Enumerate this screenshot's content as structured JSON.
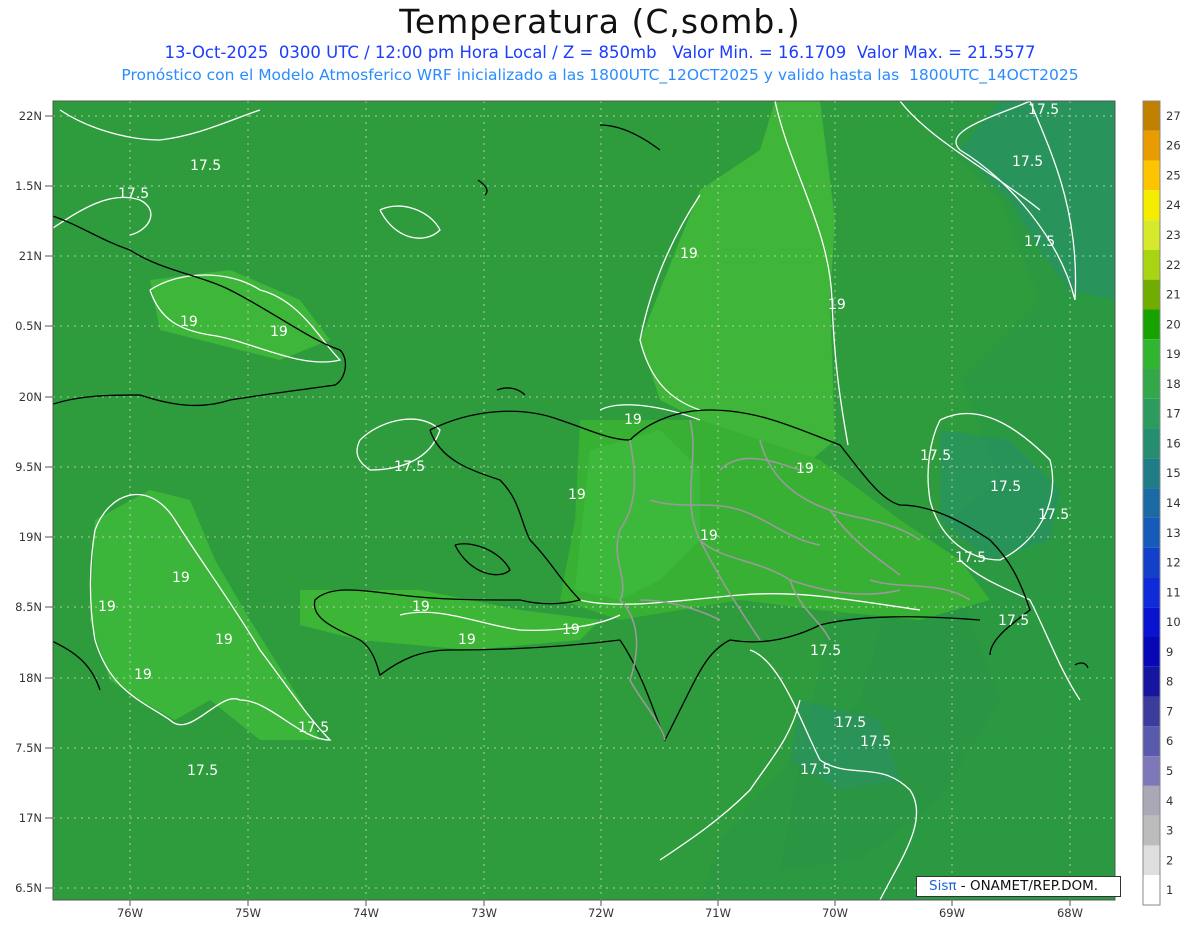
{
  "title": "Temperatura (C,somb.)",
  "subtitle_line1": "13-Oct-2025  0300 UTC / 12:00 pm Hora Local / Z = 850mb   Valor Min. = 16.1709  Valor Max. = 21.5577",
  "subtitle_line2": "Pronóstico con el Modelo Atmosferico WRF inicializado a las 1800UTC_12OCT2025 y valido hasta las  1800UTC_14OCT2025",
  "credit_sis": "Sisπ",
  "credit_rest": " - ONAMET/REP.DOM.",
  "lat_ticks": [
    "22N",
    "1.5N",
    "21N",
    "0.5N",
    "20N",
    "9.5N",
    "19N",
    "8.5N",
    "18N",
    "7.5N",
    "17N",
    "6.5N"
  ],
  "lon_ticks": [
    "76W",
    "75W",
    "74W",
    "73W",
    "72W",
    "71W",
    "70W",
    "69W",
    "68W"
  ],
  "colorbar_labels": [
    "27",
    "26",
    "25",
    "24",
    "23",
    "22",
    "21",
    "20",
    "19",
    "18",
    "17",
    "16",
    "15",
    "14",
    "13",
    "12",
    "11",
    "10",
    "9",
    "8",
    "7",
    "6",
    "5",
    "4",
    "3",
    "2",
    "1"
  ],
  "colorbar_colors": [
    "#c17f00",
    "#e89c00",
    "#ffc400",
    "#f5ed00",
    "#d6ea2b",
    "#a8d412",
    "#6fae00",
    "#18a200",
    "#2fb52f",
    "#32a84a",
    "#2d9b5e",
    "#268e70",
    "#1f7d88",
    "#1a6aa3",
    "#165bb9",
    "#1240c9",
    "#0e2ad9",
    "#0913d0",
    "#0707b6",
    "#1515a0",
    "#3c3c9f",
    "#5a5aad",
    "#7e78bb",
    "#a8a8b6",
    "#bcbcbc",
    "#dedede",
    "#ffffff"
  ],
  "contour_labels": [
    {
      "text": "17.5"
    },
    {
      "text": "17.5"
    },
    {
      "text": "19"
    },
    {
      "text": "19"
    },
    {
      "text": "19"
    },
    {
      "text": "19"
    },
    {
      "text": "19"
    },
    {
      "text": "19"
    },
    {
      "text": "19"
    },
    {
      "text": "19"
    },
    {
      "text": "19"
    },
    {
      "text": "19"
    },
    {
      "text": "19"
    },
    {
      "text": "19"
    },
    {
      "text": "19"
    },
    {
      "text": "19"
    },
    {
      "text": "19"
    },
    {
      "text": "17.5"
    },
    {
      "text": "17.5"
    },
    {
      "text": "17.5"
    },
    {
      "text": "17.5"
    },
    {
      "text": "17.5"
    },
    {
      "text": "17.5"
    },
    {
      "text": "17.5"
    },
    {
      "text": "17.5"
    },
    {
      "text": "17.5"
    },
    {
      "text": "17.5"
    },
    {
      "text": "17.5"
    }
  ]
}
